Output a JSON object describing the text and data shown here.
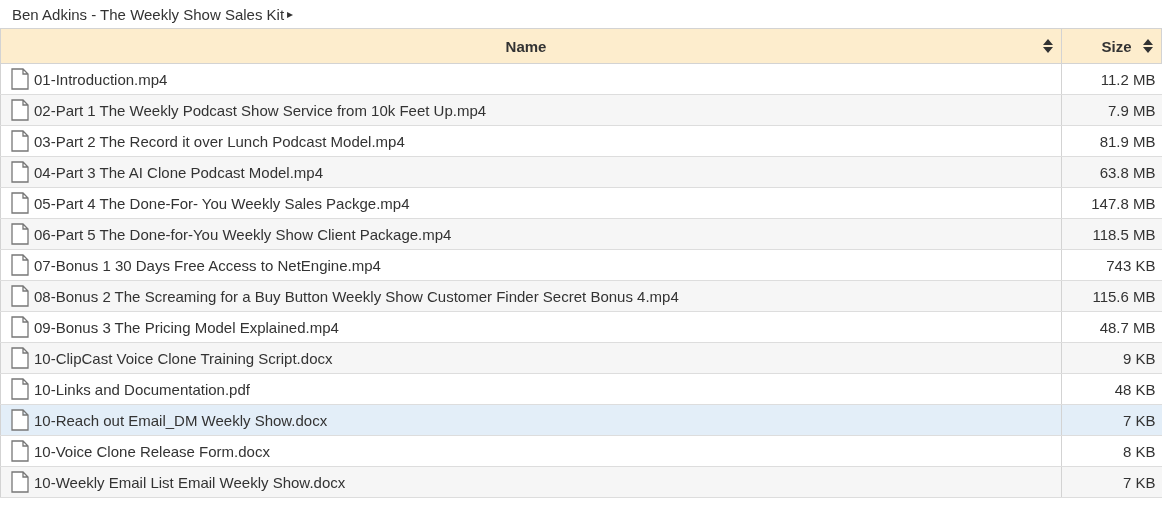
{
  "breadcrumb": {
    "title": "Ben Adkins - The Weekly Show Sales Kit",
    "arrow": "▸"
  },
  "table": {
    "columns": [
      "Name",
      "Size"
    ],
    "rows": [
      {
        "name": "01-Introduction.mp4",
        "size": "11.2 MB",
        "selected": false
      },
      {
        "name": "02-Part 1 The Weekly Podcast Show Service from 10k Feet Up.mp4",
        "size": "7.9 MB",
        "selected": false
      },
      {
        "name": "03-Part 2 The Record it over Lunch Podcast Model.mp4",
        "size": "81.9 MB",
        "selected": false
      },
      {
        "name": "04-Part 3 The AI Clone Podcast Model.mp4",
        "size": "63.8 MB",
        "selected": false
      },
      {
        "name": "05-Part 4 The Done-For- You Weekly Sales Packge.mp4",
        "size": "147.8 MB",
        "selected": false
      },
      {
        "name": "06-Part 5 The Done-for-You Weekly Show Client Package.mp4",
        "size": "118.5 MB",
        "selected": false
      },
      {
        "name": "07-Bonus 1 30 Days Free Access to NetEngine.mp4",
        "size": "743 KB",
        "selected": false
      },
      {
        "name": "08-Bonus 2 The Screaming for a Buy Button Weekly Show Customer Finder Secret Bonus 4.mp4",
        "size": "115.6 MB",
        "selected": false
      },
      {
        "name": "09-Bonus 3 The Pricing Model Explained.mp4",
        "size": "48.7 MB",
        "selected": false
      },
      {
        "name": "10-ClipCast Voice Clone Training Script.docx",
        "size": "9 KB",
        "selected": false
      },
      {
        "name": "10-Links and Documentation.pdf",
        "size": "48 KB",
        "selected": false
      },
      {
        "name": "10-Reach out Email_DM Weekly Show.docx",
        "size": "7 KB",
        "selected": true
      },
      {
        "name": "10-Voice Clone Release Form.docx",
        "size": "8 KB",
        "selected": false
      },
      {
        "name": "10-Weekly Email List Email Weekly Show.docx",
        "size": "7 KB",
        "selected": false
      }
    ]
  }
}
